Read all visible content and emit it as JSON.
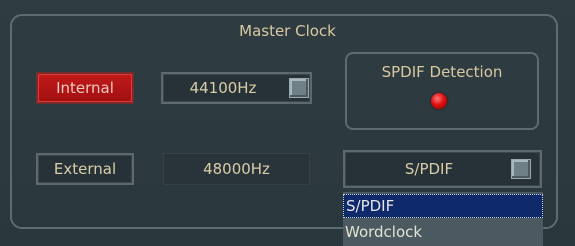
{
  "group": {
    "title": "Master Clock"
  },
  "internal_button": {
    "label": "Internal",
    "active": true
  },
  "external_button": {
    "label": "External",
    "active": false
  },
  "internal_rate": {
    "value": "44100Hz"
  },
  "external_rate": {
    "value": "48000Hz"
  },
  "spdif_detection": {
    "title": "SPDIF Detection",
    "led_color": "#e01010"
  },
  "source_select": {
    "selected": "S/PDIF",
    "options": [
      "S/PDIF",
      "Wordclock"
    ],
    "highlighted_index": 0
  },
  "colors": {
    "background": "#2c3a40",
    "active_red": "#c21a1a",
    "text": "#d9cda8",
    "highlight": "#0e2a6b"
  }
}
